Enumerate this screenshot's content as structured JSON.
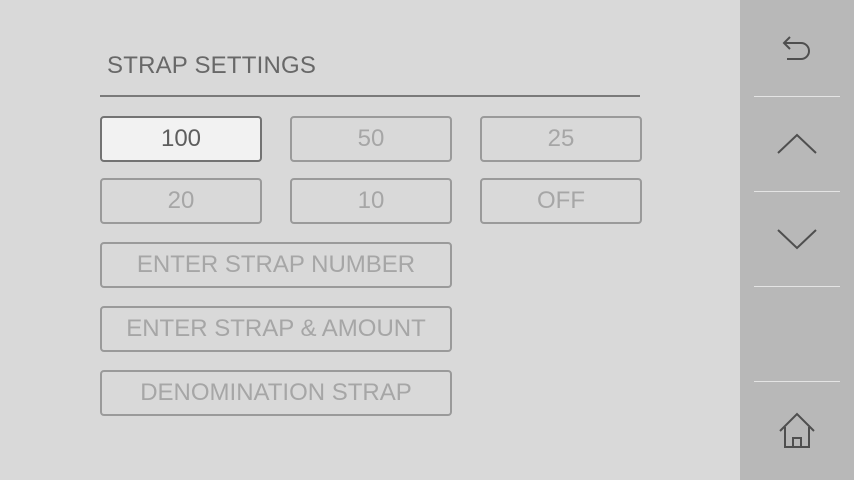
{
  "title": "STRAP SETTINGS",
  "strap_options": {
    "opt_100": "100",
    "opt_50": "50",
    "opt_25": "25",
    "opt_20": "20",
    "opt_10": "10",
    "opt_off": "OFF"
  },
  "selected_option": "100",
  "actions": {
    "enter_strap_number": "ENTER STRAP NUMBER",
    "enter_strap_amount": "ENTER STRAP & AMOUNT",
    "denomination_strap": "DENOMINATION STRAP"
  },
  "sidebar_icons": [
    "back-icon",
    "up-arrow-icon",
    "down-arrow-icon",
    "home-icon"
  ],
  "colors": {
    "background": "#d9d9d9",
    "sidebar": "#b8b8b8",
    "selected_button": "#f2f2f2",
    "text_active": "#5e5e5e",
    "text_inactive": "#a6a6a6"
  }
}
